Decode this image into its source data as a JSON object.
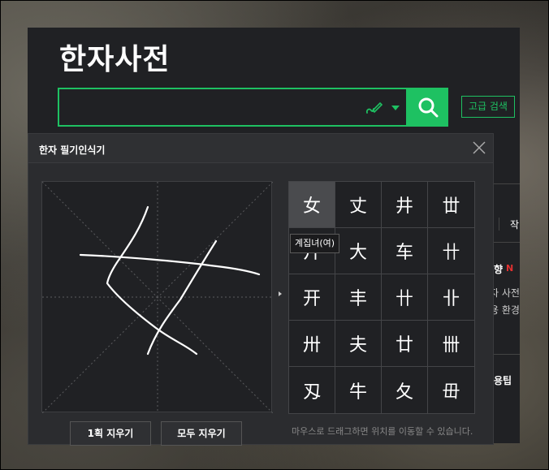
{
  "header": {
    "title": "한자사전",
    "advanced_search_label": "고급 검색"
  },
  "search": {
    "value": "",
    "placeholder": "",
    "handwriting_icon": "pen-icon",
    "search_icon": "search-icon"
  },
  "side_content": {
    "frag1": "작",
    "frag2": "향",
    "new_badge": "N",
    "frag3": "자 사전",
    "frag4": "용 환경",
    "frag5": "용팁"
  },
  "handwriting": {
    "title": "한자 필기인식기",
    "close_icon": "close-icon",
    "candidates": [
      "女",
      "丈",
      "井",
      "丗",
      "廾",
      "大",
      "车",
      "卄",
      "开",
      "丰",
      "卄",
      "卝",
      "卅",
      "夫",
      "廿",
      "卌",
      "刄",
      "牛",
      "夂",
      "毌"
    ],
    "selected_index": 0,
    "tooltip": "계집녀(여)",
    "clear_one_label": "1획 지우기",
    "clear_all_label": "모두 지우기",
    "hint": "마우스로 드래그하면 위치를 이동할 수 있습니다."
  },
  "colors": {
    "accent": "#1ec162",
    "panel_bg": "#202124",
    "popup_bg": "#2b2c2f"
  }
}
